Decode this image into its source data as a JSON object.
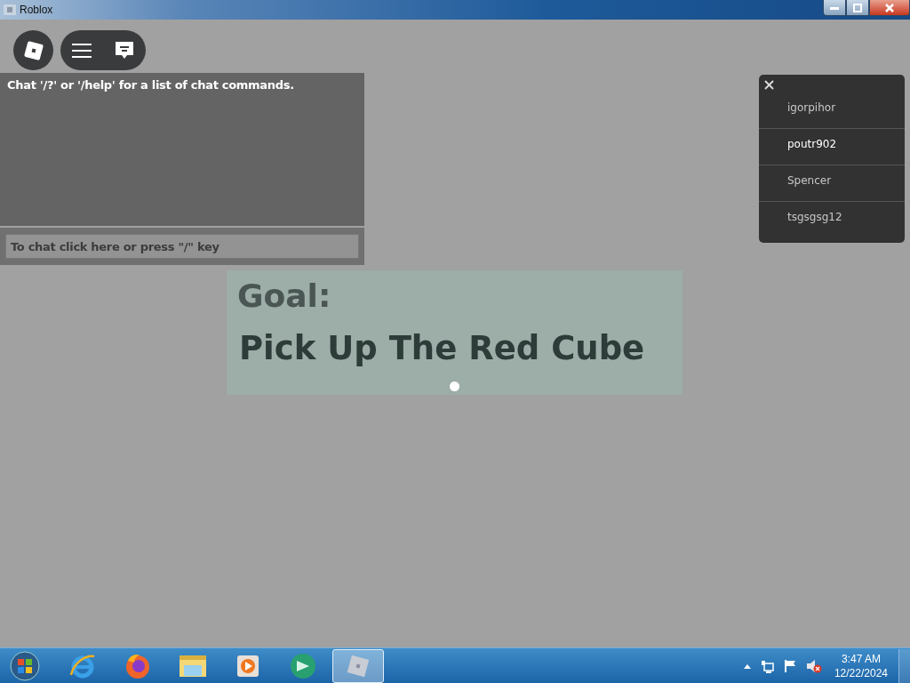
{
  "window": {
    "title": "Roblox"
  },
  "chat": {
    "system_message": "Chat '/?' or '/help' for a list of chat commands.",
    "input": {
      "placeholder": "To chat click here or press \"/\" key"
    }
  },
  "goal": {
    "heading": "Goal:",
    "text": "Pick Up The Red Cube"
  },
  "player_list": {
    "players": [
      {
        "name": "igorpihor",
        "selected": false
      },
      {
        "name": "poutr902",
        "selected": true
      },
      {
        "name": "Spencer",
        "selected": false
      },
      {
        "name": "tsgsgsg12",
        "selected": false
      }
    ]
  },
  "taskbar": {
    "apps": [
      {
        "kind": "ie",
        "selected": false
      },
      {
        "kind": "firefox",
        "selected": false
      },
      {
        "kind": "explorer",
        "selected": false
      },
      {
        "kind": "media",
        "selected": false
      },
      {
        "kind": "green",
        "selected": false
      },
      {
        "kind": "roblox",
        "selected": true
      }
    ],
    "clock": {
      "time": "3:47 AM",
      "date": "12/22/2024"
    }
  }
}
